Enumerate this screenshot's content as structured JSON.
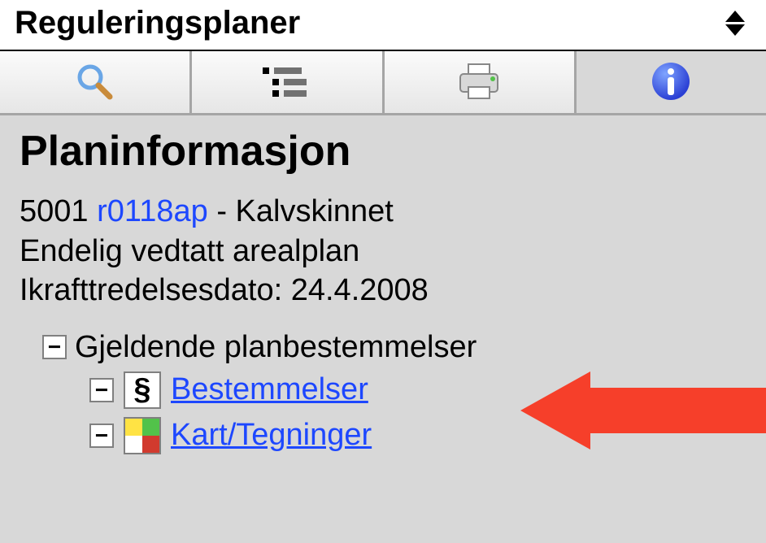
{
  "dropdown": {
    "label": "Reguleringsplaner"
  },
  "header": {
    "title": "Planinformasjon"
  },
  "plan": {
    "municipality_code": "5001",
    "plan_id": "r0118ap",
    "name": "Kalvskinnet",
    "status": "Endelig vedtatt arealplan",
    "date_label": "Ikrafttredelsesdato:",
    "date_value": "24.4.2008"
  },
  "tree": {
    "root_label": "Gjeldende planbestemmelser",
    "children": [
      {
        "label": "Bestemmelser"
      },
      {
        "label": "Kart/Tegninger"
      }
    ]
  }
}
